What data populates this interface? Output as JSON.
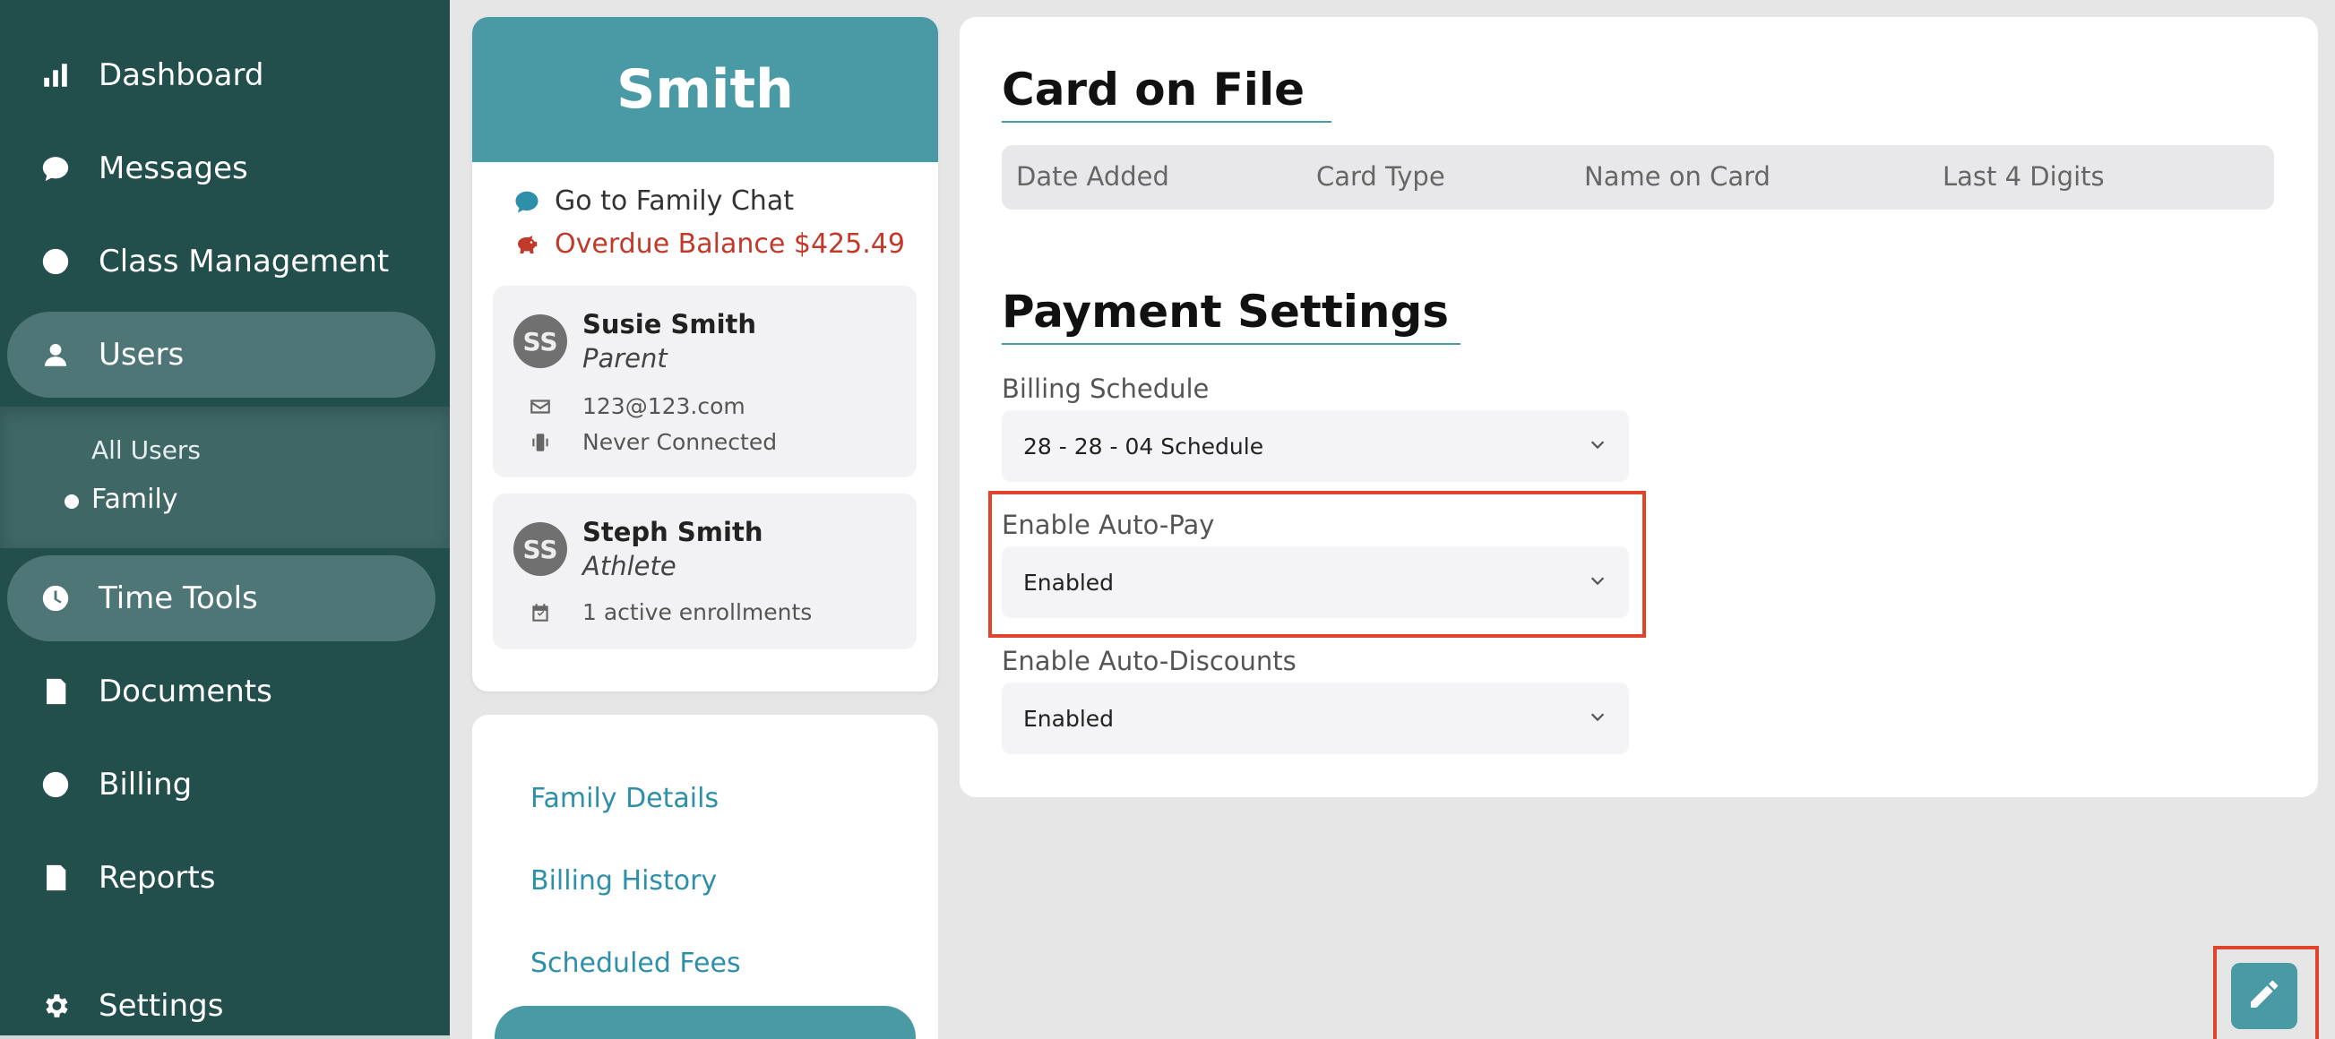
{
  "sidebar": {
    "items": [
      {
        "label": "Dashboard",
        "icon": "bar-chart-icon"
      },
      {
        "label": "Messages",
        "icon": "chat-bubble-icon"
      },
      {
        "label": "Class Management",
        "icon": "circle-icon"
      },
      {
        "label": "Users",
        "icon": "user-icon"
      },
      {
        "label": "Time Tools",
        "icon": "clock-icon"
      },
      {
        "label": "Documents",
        "icon": "document-icon"
      },
      {
        "label": "Billing",
        "icon": "circle-icon"
      },
      {
        "label": "Reports",
        "icon": "report-icon"
      },
      {
        "label": "Settings",
        "icon": "gear-icon"
      }
    ],
    "sub_items": [
      "All Users",
      "Family"
    ]
  },
  "family": {
    "name": "Smith",
    "chat_link": "Go to Family Chat",
    "overdue": "Overdue Balance $425.49",
    "members": [
      {
        "initials": "SS",
        "name": "Susie Smith",
        "role": "Parent",
        "email": "123@123.com",
        "status": "Never Connected"
      },
      {
        "initials": "SS",
        "name": "Steph Smith",
        "role": "Athlete",
        "enrollments": "1 active enrollments"
      }
    ]
  },
  "side_links": [
    "Family Details",
    "Billing History",
    "Scheduled Fees"
  ],
  "card_on_file": {
    "title": "Card on File",
    "columns": [
      "Date Added",
      "Card Type",
      "Name on Card",
      "Last 4 Digits"
    ]
  },
  "payment_settings": {
    "title": "Payment Settings",
    "billing_schedule": {
      "label": "Billing Schedule",
      "value": "28 - 28 - 04 Schedule"
    },
    "auto_pay": {
      "label": "Enable Auto-Pay",
      "value": "Enabled"
    },
    "auto_discounts": {
      "label": "Enable Auto-Discounts",
      "value": "Enabled"
    }
  },
  "colors": {
    "sidebar": "#224e4c",
    "accent": "#4a9aa6",
    "alert": "#c0392b",
    "highlight": "#e0442d"
  }
}
